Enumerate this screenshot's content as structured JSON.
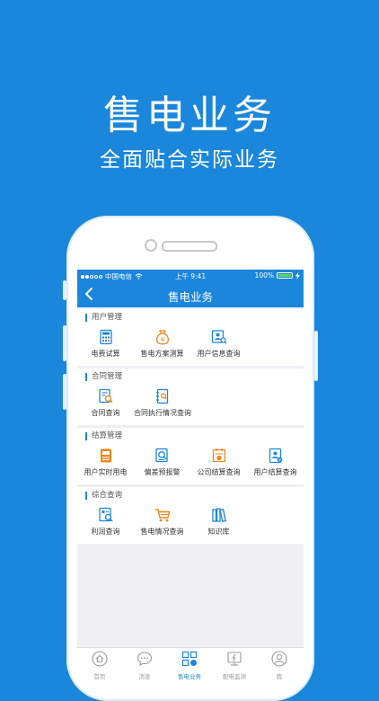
{
  "promo": {
    "headline": "售电业务",
    "subline": "全面贴合实际业务"
  },
  "status_bar": {
    "carrier": "中国电信",
    "time": "上午 9:41",
    "battery": "100%"
  },
  "nav": {
    "back_icon": "chevron-left-icon",
    "title": "售电业务"
  },
  "sections": [
    {
      "title": "用户管理",
      "items": [
        {
          "label": "电费试算",
          "icon": "calculator-icon"
        },
        {
          "label": "售电方案测算",
          "icon": "money-bag-icon"
        },
        {
          "label": "用户信息查询",
          "icon": "user-search-icon"
        }
      ]
    },
    {
      "title": "合同管理",
      "items": [
        {
          "label": "合同查询",
          "icon": "contract-search-icon"
        },
        {
          "label": "合同执行情况查询",
          "icon": "contract-book-icon"
        }
      ]
    },
    {
      "title": "结算管理",
      "items": [
        {
          "label": "用户实时用电",
          "icon": "realtime-usage-icon"
        },
        {
          "label": "偏差预报警",
          "icon": "deviation-alert-icon"
        },
        {
          "label": "公司结算查询",
          "icon": "company-settlement-icon"
        },
        {
          "label": "用户结算查询",
          "icon": "user-settlement-icon"
        }
      ]
    },
    {
      "title": "综合查询",
      "items": [
        {
          "label": "利润查询",
          "icon": "profit-search-icon"
        },
        {
          "label": "售电情况查询",
          "icon": "cart-icon"
        },
        {
          "label": "知识库",
          "icon": "books-icon"
        }
      ]
    }
  ],
  "tabs": [
    {
      "label": "首页",
      "icon": "home-icon",
      "active": false
    },
    {
      "label": "消息",
      "icon": "chat-icon",
      "active": false
    },
    {
      "label": "售电业务",
      "icon": "grid-icon",
      "active": true
    },
    {
      "label": "配电监测",
      "icon": "monitor-icon",
      "active": false
    },
    {
      "label": "我",
      "icon": "user-icon",
      "active": false
    }
  ],
  "colors": {
    "brand": "#1b86dc",
    "accent": "#f08519"
  }
}
